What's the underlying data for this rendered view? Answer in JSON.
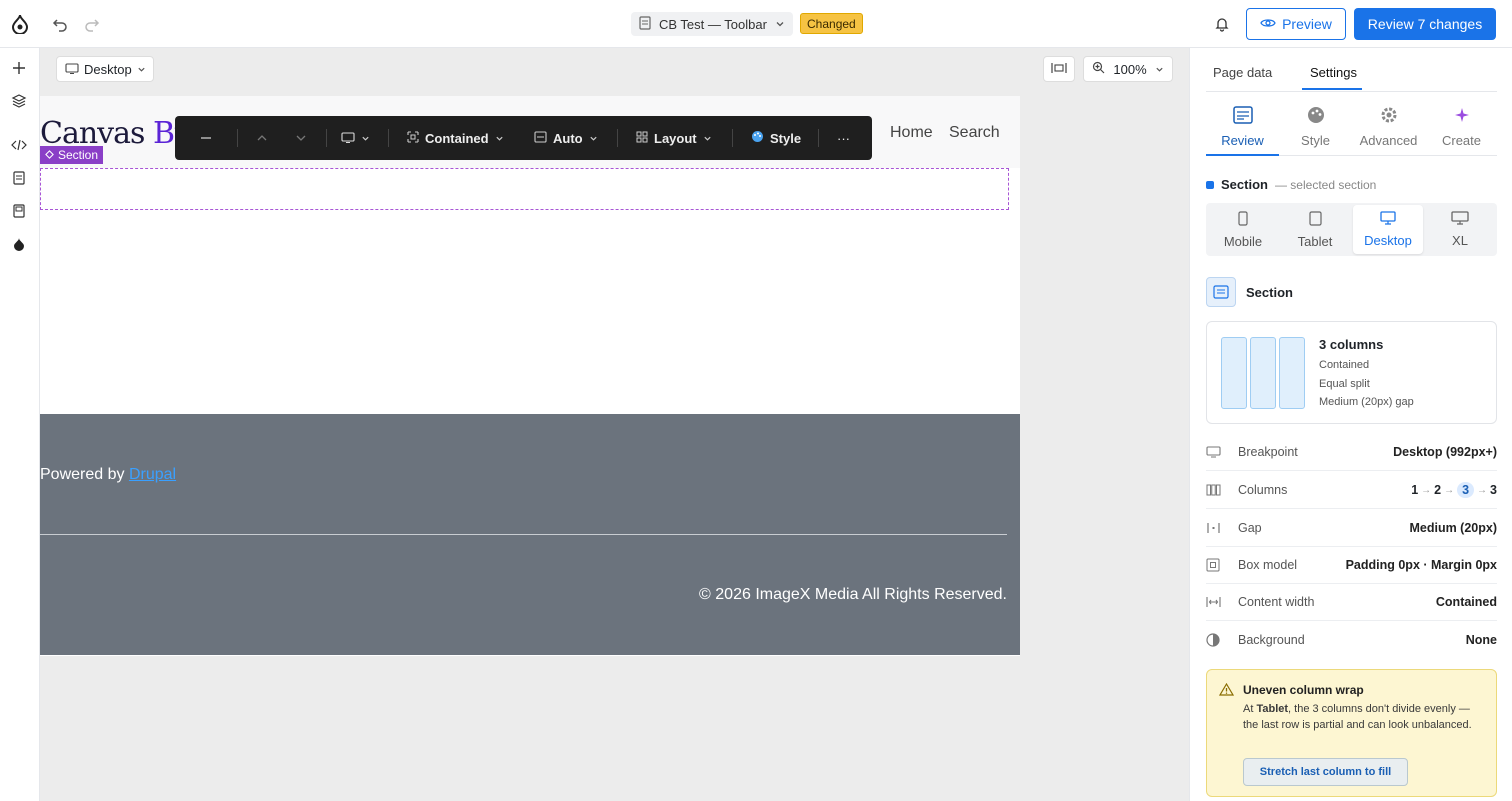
{
  "topbar": {
    "doc_title": "CB Test — Toolbar",
    "status_badge": "Changed",
    "preview_label": "Preview",
    "review_label": "Review 7 changes"
  },
  "canvas": {
    "viewport": "Desktop",
    "zoom": "100%"
  },
  "site": {
    "logo_main": "Canvas ",
    "logo_accent": "Bu",
    "nav": [
      "Home",
      "Search"
    ],
    "section_tag": "Section",
    "powered_prefix": "Powered by ",
    "powered_link": "Drupal",
    "copyright": "© 2026 ImageX Media All Rights Reserved."
  },
  "toolbar": {
    "width_label": "Contained",
    "height_label": "Auto",
    "layout_label": "Layout",
    "style_label": "Style",
    "more_label": "···"
  },
  "panel": {
    "tabs": [
      "Page data",
      "Settings"
    ],
    "modes": [
      "Review",
      "Style",
      "Advanced",
      "Create"
    ],
    "selection_name": "Section",
    "selection_note": "— selected section",
    "breakpoints": [
      "Mobile",
      "Tablet",
      "Desktop",
      "XL"
    ],
    "component_name": "Section",
    "columns_card": {
      "title": "3 columns",
      "lines": [
        "Contained",
        "Equal split",
        "Medium (20px) gap"
      ]
    },
    "props": {
      "breakpoint": {
        "label": "Breakpoint",
        "value": "Desktop (992px+)"
      },
      "columns": {
        "label": "Columns",
        "chain": [
          "1",
          "2",
          "3",
          "3"
        ]
      },
      "gap": {
        "label": "Gap",
        "value": "Medium (20px)"
      },
      "box_model": {
        "label": "Box model",
        "value": "Padding 0px · Margin 0px"
      },
      "content_width": {
        "label": "Content width",
        "value": "Contained"
      },
      "background": {
        "label": "Background",
        "value": "None"
      }
    },
    "warning": {
      "title": "Uneven column wrap",
      "body_prefix": "At ",
      "body_bold": "Tablet",
      "body_rest": ", the 3 columns don't divide evenly — the last row is partial and can look unbalanced.",
      "action": "Stretch last column to fill"
    }
  },
  "colors": {
    "accent": "#1a73e8",
    "section_purple": "#8a3fc7",
    "footer_bg": "#6b737d",
    "changed_badge": "#f6c343"
  }
}
